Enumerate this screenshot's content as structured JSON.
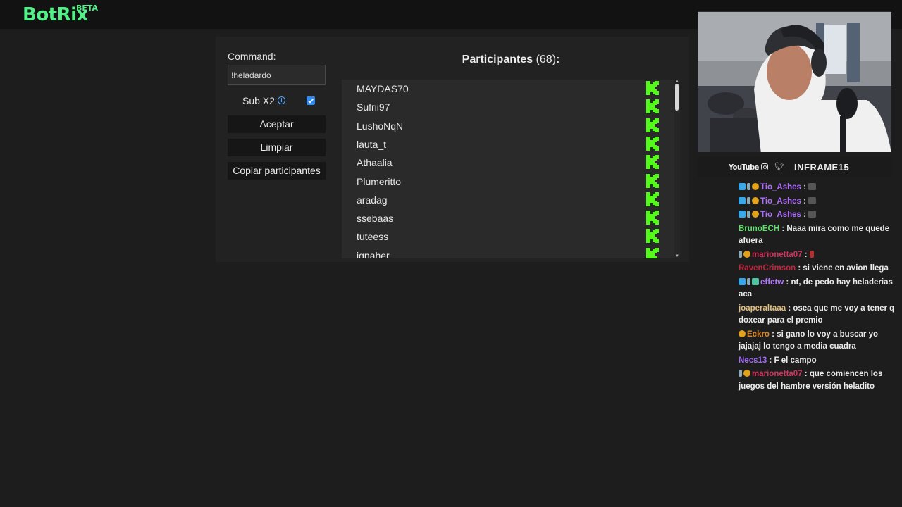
{
  "app": {
    "name": "BotRix",
    "badge": "BETA",
    "accent": "#53f08a"
  },
  "form": {
    "command_label": "Command:",
    "command_value": "!heladardo",
    "sub_label": "Sub X2",
    "sub_checked": true,
    "buttons": {
      "accept": "Aceptar",
      "clear": "Limpiar",
      "copy": "Copiar participantes"
    }
  },
  "participants": {
    "title": "Participantes",
    "count": "(68)",
    "colon": ":",
    "platform_icon": "kick-icon",
    "platform_color": "#53fc18",
    "items": [
      "MAYDAS70",
      "Sufrii97",
      "LushoNqN",
      "lauta_t",
      "Athaalia",
      "Plumeritto",
      "aradag",
      "ssebaas",
      "tuteess",
      "ignaher"
    ]
  },
  "stream_overlay": {
    "youtube": "YouTube",
    "handle": "INFRAME15"
  },
  "chat": [
    {
      "user": "Tio_Ashes",
      "color": "#b070ff",
      "sep": " :",
      "text": ""
    },
    {
      "user": "Tio_Ashes",
      "color": "#b070ff",
      "sep": " :",
      "text": ""
    },
    {
      "user": "Tio_Ashes",
      "color": "#b070ff",
      "sep": " :",
      "text": ""
    },
    {
      "user": "BrunoECH",
      "color": "#5ee06a",
      "sep": " :",
      "text": " Naaa mira como me quede afuera"
    },
    {
      "user": "marionetta07",
      "color": "#d2335c",
      "sep": " :",
      "text": ""
    },
    {
      "user": "RavenCrimson",
      "color": "#c1263d",
      "sep": " :",
      "text": " si viene en avion llega"
    },
    {
      "user": "effetw",
      "color": "#b47cff",
      "sep": " :",
      "text": " nt, de pedo hay heladerias aca"
    },
    {
      "user": "joaperaltaaa",
      "color": "#e6c07a",
      "sep": " :",
      "text": " osea que me voy a tener q doxear para el premio"
    },
    {
      "user": "Eckro",
      "color": "#e58a1f",
      "sep": " :",
      "text": " si gano lo voy a buscar yo jajajaj lo tengo a media cuadra"
    },
    {
      "user": "Necs13",
      "color": "#a26bff",
      "sep": " :",
      "text": " F el campo"
    },
    {
      "user": "marionetta07",
      "color": "#d2335c",
      "sep": " :",
      "text": " que comiencen los juegos del hambre versión heladito"
    }
  ]
}
